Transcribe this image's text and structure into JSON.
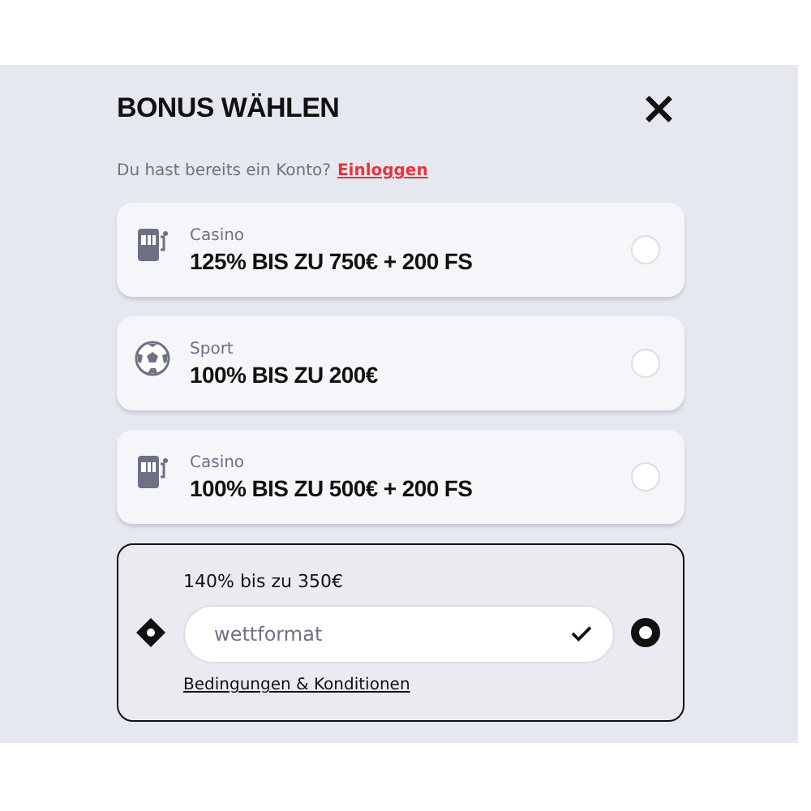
{
  "dialog": {
    "title": "BONUS WÄHLEN",
    "close": "×",
    "login_prompt": "Du hast bereits ein Konto?",
    "login_link": "Einloggen"
  },
  "options": [
    {
      "kind": "casino",
      "category": "Casino",
      "title": "125% BIS ZU 750€ + 200 FS",
      "selected": false
    },
    {
      "kind": "sport",
      "category": "Sport",
      "title": "100% BIS ZU 200€",
      "selected": false
    },
    {
      "kind": "casino",
      "category": "Casino",
      "title": "100% BIS ZU 500€ + 200 FS",
      "selected": false
    },
    {
      "kind": "code",
      "title": "140% bis zu 350€",
      "code": "wettformat",
      "valid": true,
      "terms": "Bedingungen & Konditionen",
      "selected": true
    }
  ]
}
